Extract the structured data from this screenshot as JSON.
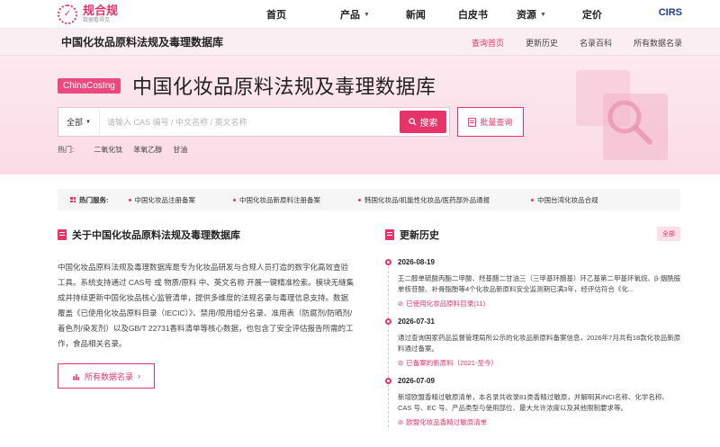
{
  "brand": {
    "logo_name": "规合规",
    "logo_sub": "数据看得见"
  },
  "nav": {
    "items": [
      {
        "label": "首页",
        "caret": false
      },
      {
        "label": "产品",
        "caret": true
      },
      {
        "label": "新闻",
        "caret": false
      },
      {
        "label": "白皮书",
        "caret": false
      },
      {
        "label": "资源",
        "caret": true
      },
      {
        "label": "定价",
        "caret": false
      }
    ],
    "partner": "CIRS"
  },
  "subheader": {
    "title": "中国化妆品原料法规及毒理数据库",
    "links": [
      "查询首页",
      "更新历史",
      "名录百科",
      "所有数据名录"
    ],
    "active": 0
  },
  "hero": {
    "tag": "ChinaCosIng",
    "title": "中国化妆品原料法规及毒理数据库",
    "search": {
      "scope": "全部",
      "placeholder": "请输入 CAS 编号 / 中文名称 / 英文名称",
      "button": "搜索"
    },
    "batch_button": "批量查询",
    "hot_label": "热门:",
    "hot_items": [
      "二氧化钛",
      "苯氧乙醇",
      "甘油"
    ]
  },
  "services": {
    "label": "热门服务:",
    "items": [
      "中国化妆品注册备案",
      "中国化妆品新原料注册备案",
      "韩国化妆品/机能性化妆品/医药部外品通报",
      "中国台湾化妆品合规"
    ]
  },
  "about": {
    "title": "关于中国化妆品原料法规及毒理数据库",
    "text": "中国化妆品原料法规及毒理数据库是专为化妆品研发与合规人员打造的数字化高效查验工具。系统支持通过 CAS号 或 物质/原料 中、英文名称 开展一键精准检索。模块无缝集成并持续更新中国化妆品核心监管清单，提供多维度的法规名录与毒理信息支持。数据覆盖《已使用化妆品原料目录（IECIC）》、禁用/限用组分名录、准用表（防腐剂/防晒剂/着色剂/染发剂）以及GB/T 22731香料清单等核心数据，也包含了安全评估报告所需的工作，食品相关名录。",
    "button": "所有数据名录"
  },
  "history": {
    "title": "更新历史",
    "all_label": "全部",
    "items": [
      {
        "date": "2026-08-19",
        "text": "王二醇单硫酸丙酯二甲酸、羟基醋二甘油三（三甲基环醋基）环乙基第二甲基环氧烷、β-烟酰胺单核苷酸、补骨脂酚等4个化妆品新原料安全监测期已满3年，经评估符合《化...",
        "link": "已使用化妆品原料目录(11)"
      },
      {
        "date": "2026-07-31",
        "text": "通过查询国家药品监督管理局所公示的化妆品新原料备案信息，2026年7月共有18款化妆品新原料通过备案。",
        "link": "已备案的新原料（2021-至今）"
      },
      {
        "date": "2026-07-09",
        "text": "新增欧盟香精过敏原清单，本名录共收录81类香精过敏原，并解明其INCI名称、化学名称、CAS 号、EC 号、产品类型与使用部位、最大允许浓度以及其他限制要求等。",
        "link": "欧盟化妆品香精过敏原清单"
      }
    ]
  },
  "colors": {
    "accent": "#e8336a",
    "hero_bg": "#fde9ef",
    "partner": "#1a3d8f"
  }
}
